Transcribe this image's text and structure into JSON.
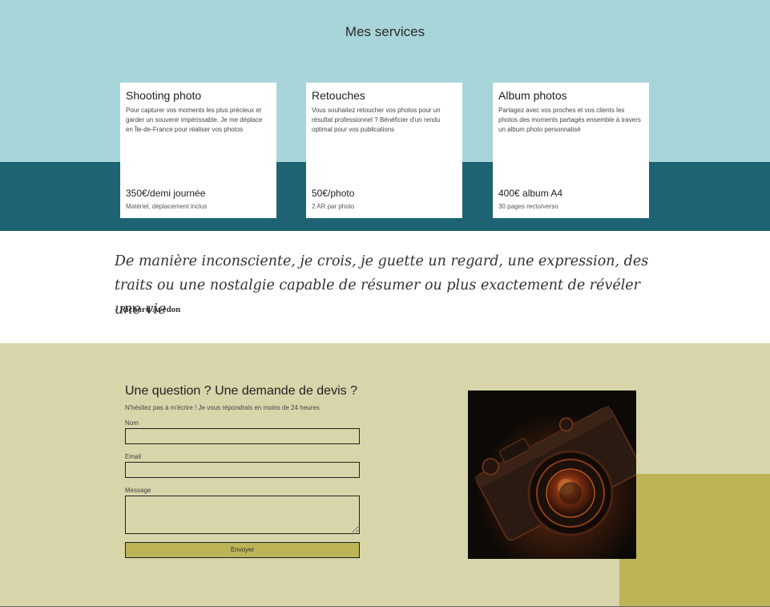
{
  "services": {
    "title": "Mes services",
    "cards": [
      {
        "title": "Shooting photo",
        "description": "Pour capturer vos moments les plus précieux et garder un souvenir impérissable. Je me déplace en Île-de-France pour réaliser vos photos",
        "price": "350€/demi journée",
        "note": "Matériel, déplacement inclus"
      },
      {
        "title": "Retouches",
        "description": "Vous souhaitez retoucher vos photos pour un résultat professionnel ? Bénéficier d'un rendu optimal pour vos publications",
        "price": "50€/photo",
        "note": "2 AR par photo"
      },
      {
        "title": "Album photos",
        "description": "Partagez avec vos proches et vos clients les photos des moments partagés ensemble à travers un album photo personnalisé",
        "price": "400€ album A4",
        "note": "30 pages recto/verso"
      }
    ]
  },
  "quote": {
    "text": "De manière inconsciente, je crois, je guette un regard, une expression, des traits ou une nostalgie capable de résumer ou plus exactement de révéler une vie",
    "author": "- Richard Avedon"
  },
  "contact": {
    "title": "Une question ? Une demande de devis ?",
    "subtitle": "N'hésitez pas à m'écrire ! Je vous répondrais en moins de 24 heures",
    "fields": {
      "name_label": "Nom",
      "email_label": "Email",
      "message_label": "Message"
    },
    "submit_label": "Envoyer"
  },
  "colors": {
    "services_top": "#a8d5d9",
    "services_bottom": "#1d6373",
    "contact_bg": "#d8d5aa",
    "accent": "#bcb457"
  }
}
